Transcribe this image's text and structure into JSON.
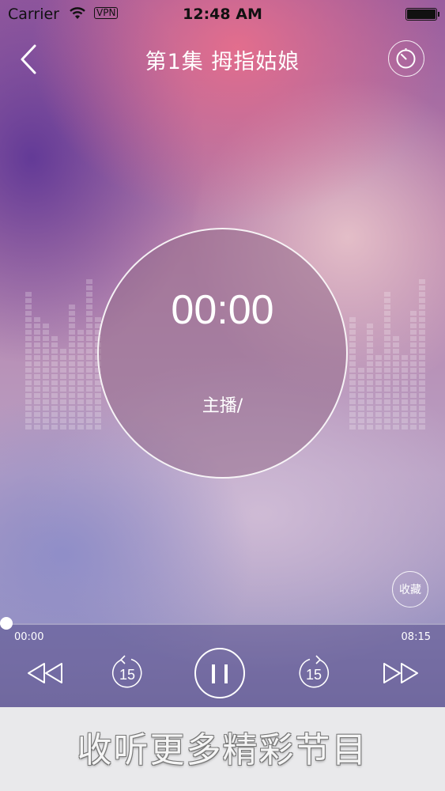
{
  "status_bar": {
    "carrier": "Carrier",
    "vpn": "VPN",
    "time": "12:48 AM"
  },
  "nav": {
    "title": "第1集  拇指姑娘",
    "back_icon": "chevron-left-icon",
    "timer_icon": "sleep-timer-icon"
  },
  "disc": {
    "elapsed": "00:00",
    "host": "主播/"
  },
  "favorite": {
    "label": "收藏"
  },
  "player": {
    "current_time": "00:00",
    "total_time": "08:15",
    "progress": 0.0,
    "skip_seconds_back": "15",
    "skip_seconds_forward": "15"
  },
  "banner": {
    "text": "收听更多精彩节目"
  },
  "colors": {
    "accent": "#ffffff",
    "banner_bg": "#e9e9eb",
    "player_bg": "#5a508c"
  }
}
